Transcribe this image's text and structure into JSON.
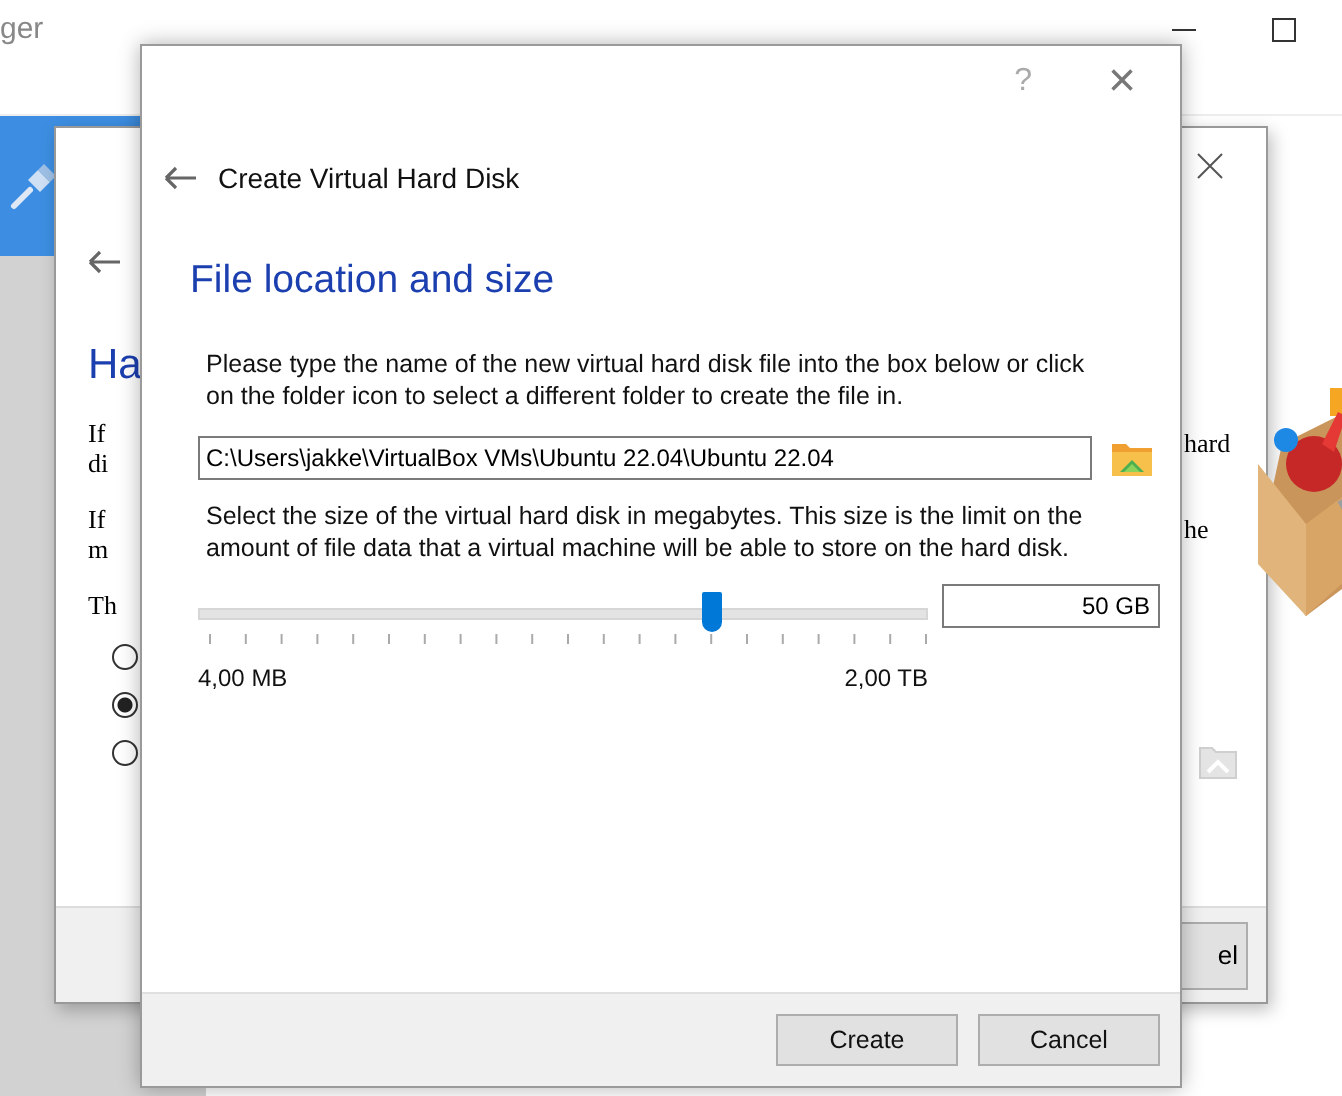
{
  "manager_window": {
    "title": "ger"
  },
  "wizard_dialog": {
    "heading": "Ha",
    "left_texts": [
      "If",
      "di",
      "If",
      "m",
      "Th"
    ],
    "radios": [
      {
        "selected": false
      },
      {
        "selected": true
      },
      {
        "selected": false
      }
    ],
    "right_texts": [
      "hard",
      "he"
    ],
    "button": "el"
  },
  "dialog": {
    "help": "?",
    "close": "×",
    "title": "Create Virtual Hard Disk",
    "heading": "File location and size",
    "intro": "Please type the name of the new virtual hard disk file into the box below or click on the folder icon to select a different folder to create the file in.",
    "path": "C:\\Users\\jakke\\VirtualBox VMs\\Ubuntu 22.04\\Ubuntu 22.04",
    "size_text": "Select the size of the virtual hard disk in megabytes. This size is the limit on the amount of file data that a virtual machine will be able to store on the hard disk.",
    "slider": {
      "level": 0.704,
      "min_label": "4,00 MB",
      "max_label": "2,00 TB"
    },
    "size": "50 GB",
    "buttons": [
      "Create",
      "Cancel"
    ]
  }
}
